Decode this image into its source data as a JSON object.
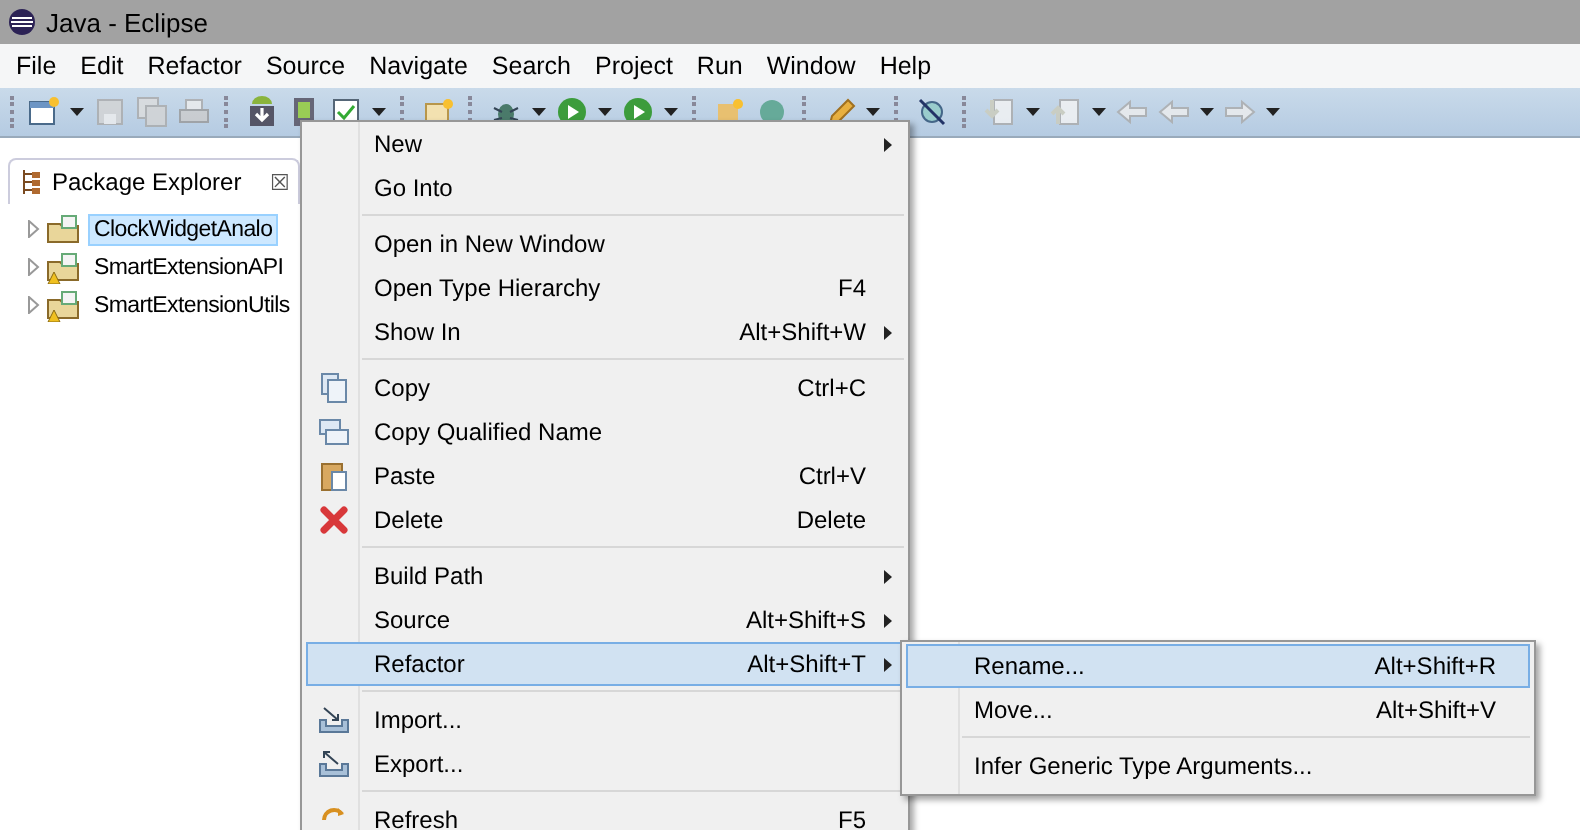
{
  "window": {
    "title": "Java - Eclipse"
  },
  "menubar": [
    "File",
    "Edit",
    "Refactor",
    "Source",
    "Navigate",
    "Search",
    "Project",
    "Run",
    "Window",
    "Help"
  ],
  "view": {
    "title": "Package Explorer",
    "close": "☒"
  },
  "tree": [
    {
      "label": "ClockWidgetAnalo",
      "selected": true,
      "warning": false
    },
    {
      "label": "SmartExtensionAPI",
      "selected": false,
      "warning": true
    },
    {
      "label": "SmartExtensionUtils",
      "selected": false,
      "warning": true
    }
  ],
  "context_menu": [
    {
      "kind": "item",
      "label": "New",
      "submenu": true,
      "selected": false
    },
    {
      "kind": "item",
      "label": "Go Into",
      "submenu": false,
      "selected": false
    },
    {
      "kind": "separator"
    },
    {
      "kind": "item",
      "label": "Open in New Window",
      "submenu": false,
      "selected": false
    },
    {
      "kind": "item",
      "label": "Open Type Hierarchy",
      "shortcut": "F4",
      "submenu": false,
      "selected": false
    },
    {
      "kind": "item",
      "label": "Show In",
      "shortcut": "Alt+Shift+W",
      "submenu": true,
      "selected": false
    },
    {
      "kind": "separator"
    },
    {
      "kind": "item",
      "label": "Copy",
      "shortcut": "Ctrl+C",
      "submenu": false,
      "selected": false
    },
    {
      "kind": "item",
      "label": "Copy Qualified Name",
      "submenu": false,
      "selected": false
    },
    {
      "kind": "item",
      "label": "Paste",
      "shortcut": "Ctrl+V",
      "submenu": false,
      "selected": false
    },
    {
      "kind": "item",
      "label": "Delete",
      "shortcut": "Delete",
      "submenu": false,
      "selected": false
    },
    {
      "kind": "separator"
    },
    {
      "kind": "item",
      "label": "Build Path",
      "submenu": true,
      "selected": false
    },
    {
      "kind": "item",
      "label": "Source",
      "shortcut": "Alt+Shift+S",
      "submenu": true,
      "selected": false
    },
    {
      "kind": "item",
      "label": "Refactor",
      "shortcut": "Alt+Shift+T",
      "submenu": true,
      "selected": true
    },
    {
      "kind": "separator"
    },
    {
      "kind": "item",
      "label": "Import...",
      "submenu": false,
      "selected": false
    },
    {
      "kind": "item",
      "label": "Export...",
      "submenu": false,
      "selected": false
    },
    {
      "kind": "separator"
    },
    {
      "kind": "item",
      "label": "Refresh",
      "shortcut": "F5",
      "submenu": false,
      "selected": false
    }
  ],
  "submenu": [
    {
      "kind": "item",
      "label": "Rename...",
      "shortcut": "Alt+Shift+R",
      "selected": true
    },
    {
      "kind": "item",
      "label": "Move...",
      "shortcut": "Alt+Shift+V",
      "selected": false
    },
    {
      "kind": "separator"
    },
    {
      "kind": "item",
      "label": "Infer Generic Type Arguments...",
      "selected": false
    }
  ]
}
